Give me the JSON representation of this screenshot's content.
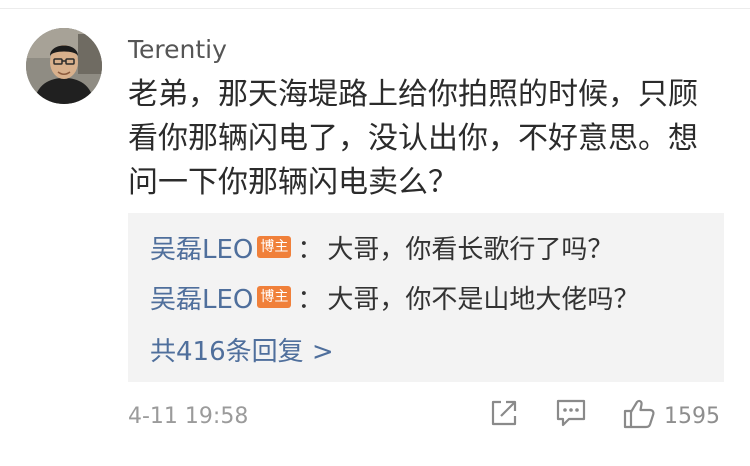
{
  "comment": {
    "username": "Terentiy",
    "text": "老弟，那天海堤路上给你拍照的时候，只顾看你那辆闪电了，没认出你，不好意思。想问一下你那辆闪电卖么？",
    "timestamp": "4-11 19:58"
  },
  "replies": {
    "items": [
      {
        "author": "吴磊LEO",
        "badge": "博主",
        "separator": "：",
        "text": "大哥，你看长歌行了吗？"
      },
      {
        "author": "吴磊LEO",
        "badge": "博主",
        "separator": "：",
        "text": "大哥，你不是山地大佬吗？"
      }
    ],
    "total_label": "共416条回复 >"
  },
  "actions": {
    "share_icon": "share-icon",
    "comment_icon": "comment-icon",
    "like_icon": "thumbs-up-icon",
    "like_count": "1595"
  },
  "colors": {
    "link": "#4f6f9c",
    "badge": "#f0803a",
    "reply_bg": "#f3f3f3",
    "meta": "#9b9b9b"
  }
}
